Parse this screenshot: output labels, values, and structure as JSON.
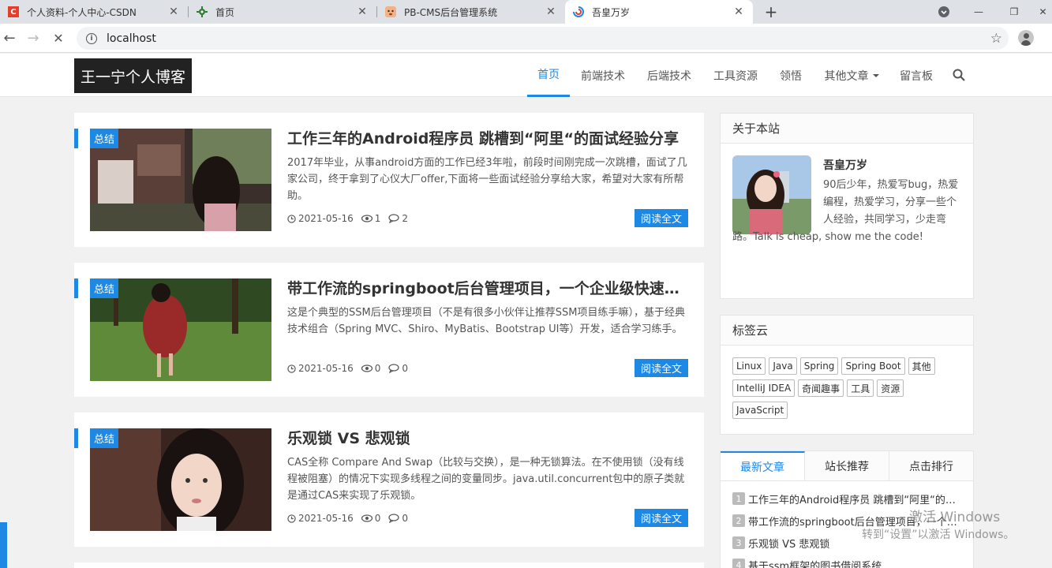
{
  "browser": {
    "tabs": [
      {
        "title": "个人资料-个人中心-CSDN",
        "favicon": "C"
      },
      {
        "title": "首页",
        "favicon": "gear"
      },
      {
        "title": "PB-CMS后台管理系统",
        "favicon": "dog"
      },
      {
        "title": "吾皇万岁",
        "favicon": "swirl"
      }
    ],
    "url": "localhost"
  },
  "site": {
    "logo": "王一宁个人博客",
    "nav": [
      "首页",
      "前端技术",
      "后端技术",
      "工具资源",
      "领悟",
      "其他文章",
      "留言板"
    ]
  },
  "articles": [
    {
      "category": "总结",
      "title": "工作三年的Android程序员 跳槽到“阿里“的面试经验分享",
      "summary": "2017年毕业，从事android方面的工作已经3年啦，前段时间刚完成一次跳槽，面试了几家公司，终于拿到了心仪大厂offer,下面将一些面试经验分享给大家，希望对大家有所帮助。",
      "date": "2021-05-16",
      "views": "1",
      "comments": "2",
      "read_more": "阅读全文"
    },
    {
      "category": "总结",
      "title": "带工作流的springboot后台管理项目，一个企业级快速开发解决方案",
      "summary": "这是个典型的SSM后台管理项目（不是有很多小伙伴让推荐SSM项目练手嘛），基于经典技术组合（Spring MVC、Shiro、MyBatis、Bootstrap UI等）开发，适合学习练手。",
      "date": "2021-05-16",
      "views": "0",
      "comments": "0",
      "read_more": "阅读全文"
    },
    {
      "category": "总结",
      "title": "乐观锁 VS 悲观锁",
      "summary": "CAS全称 Compare And Swap（比较与交换），是一种无锁算法。在不使用锁（没有线程被阻塞）的情况下实现多线程之间的变量同步。java.util.concurrent包中的原子类就是通过CAS来实现了乐观锁。",
      "date": "2021-05-16",
      "views": "0",
      "comments": "0",
      "read_more": "阅读全文"
    }
  ],
  "sidebar": {
    "about": {
      "heading": "关于本站",
      "name": "吾皇万岁",
      "bio": "90后少年，热爱写bug，热爱编程，热爱学习，分享一些个人经验，共同学习，少走弯路。Talk is cheap, show me the code!"
    },
    "tags": {
      "heading": "标签云",
      "items": [
        "Linux",
        "Java",
        "Spring",
        "Spring Boot",
        "其他",
        "IntelliJ IDEA",
        "奇闻趣事",
        "工具",
        "资源",
        "JavaScript"
      ]
    },
    "tabs": [
      "最新文章",
      "站长推荐",
      "点击排行"
    ],
    "latest": [
      "工作三年的Android程序员 跳槽到“阿里“的面试经验分享",
      "带工作流的springboot后台管理项目，一个企业级快速开发解决方案",
      "乐观锁 VS 悲观锁",
      "基于ssm框架的图书借阅系统"
    ]
  },
  "watermark": {
    "line1": "激活 Windows",
    "line2": "转到“设置”以激活 Windows。"
  },
  "colors": {
    "accent": "#1e88e5",
    "logo_bg": "#222222"
  }
}
